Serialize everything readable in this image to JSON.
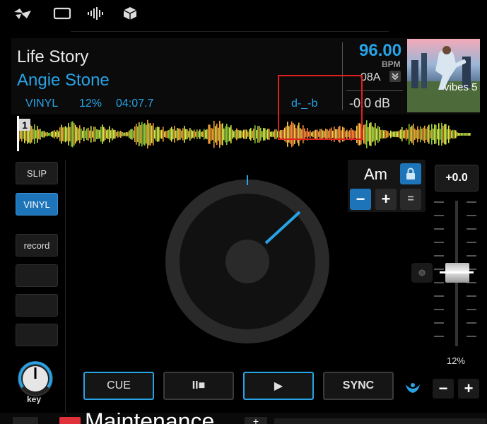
{
  "toolbar": {
    "icons": [
      "logo-icon",
      "window-icon",
      "waveform-icon",
      "cube-icon"
    ]
  },
  "track": {
    "title": "Life Story",
    "artist": "Angie Stone",
    "mode": "VINYL",
    "pitch_percent": "12%",
    "time": "04:07.7",
    "loop_display": "d-_-b",
    "bpm": "96.00",
    "bpm_label": "BPM",
    "key": "08A",
    "gain": "-0.0 dB",
    "album_text": "vibes 5",
    "cue_marker": "1"
  },
  "left_buttons": {
    "slip": "SLIP",
    "vinyl": "VINYL",
    "record": "record",
    "key_knob_label": "key"
  },
  "transport": {
    "cue": "CUE",
    "pause": "II■",
    "play": "▶",
    "sync": "SYNC"
  },
  "key_panel": {
    "key": "Am",
    "minus": "−",
    "plus": "+",
    "equal": "="
  },
  "pitch": {
    "value": "+0.0",
    "range": "12%",
    "minus": "−",
    "plus": "+"
  },
  "bottom": {
    "folder_title": "Maintenance",
    "add": "+"
  },
  "colors": {
    "accent": "#27a3e6",
    "active_button": "#1e74b8",
    "highlight_box": "#e02020"
  }
}
